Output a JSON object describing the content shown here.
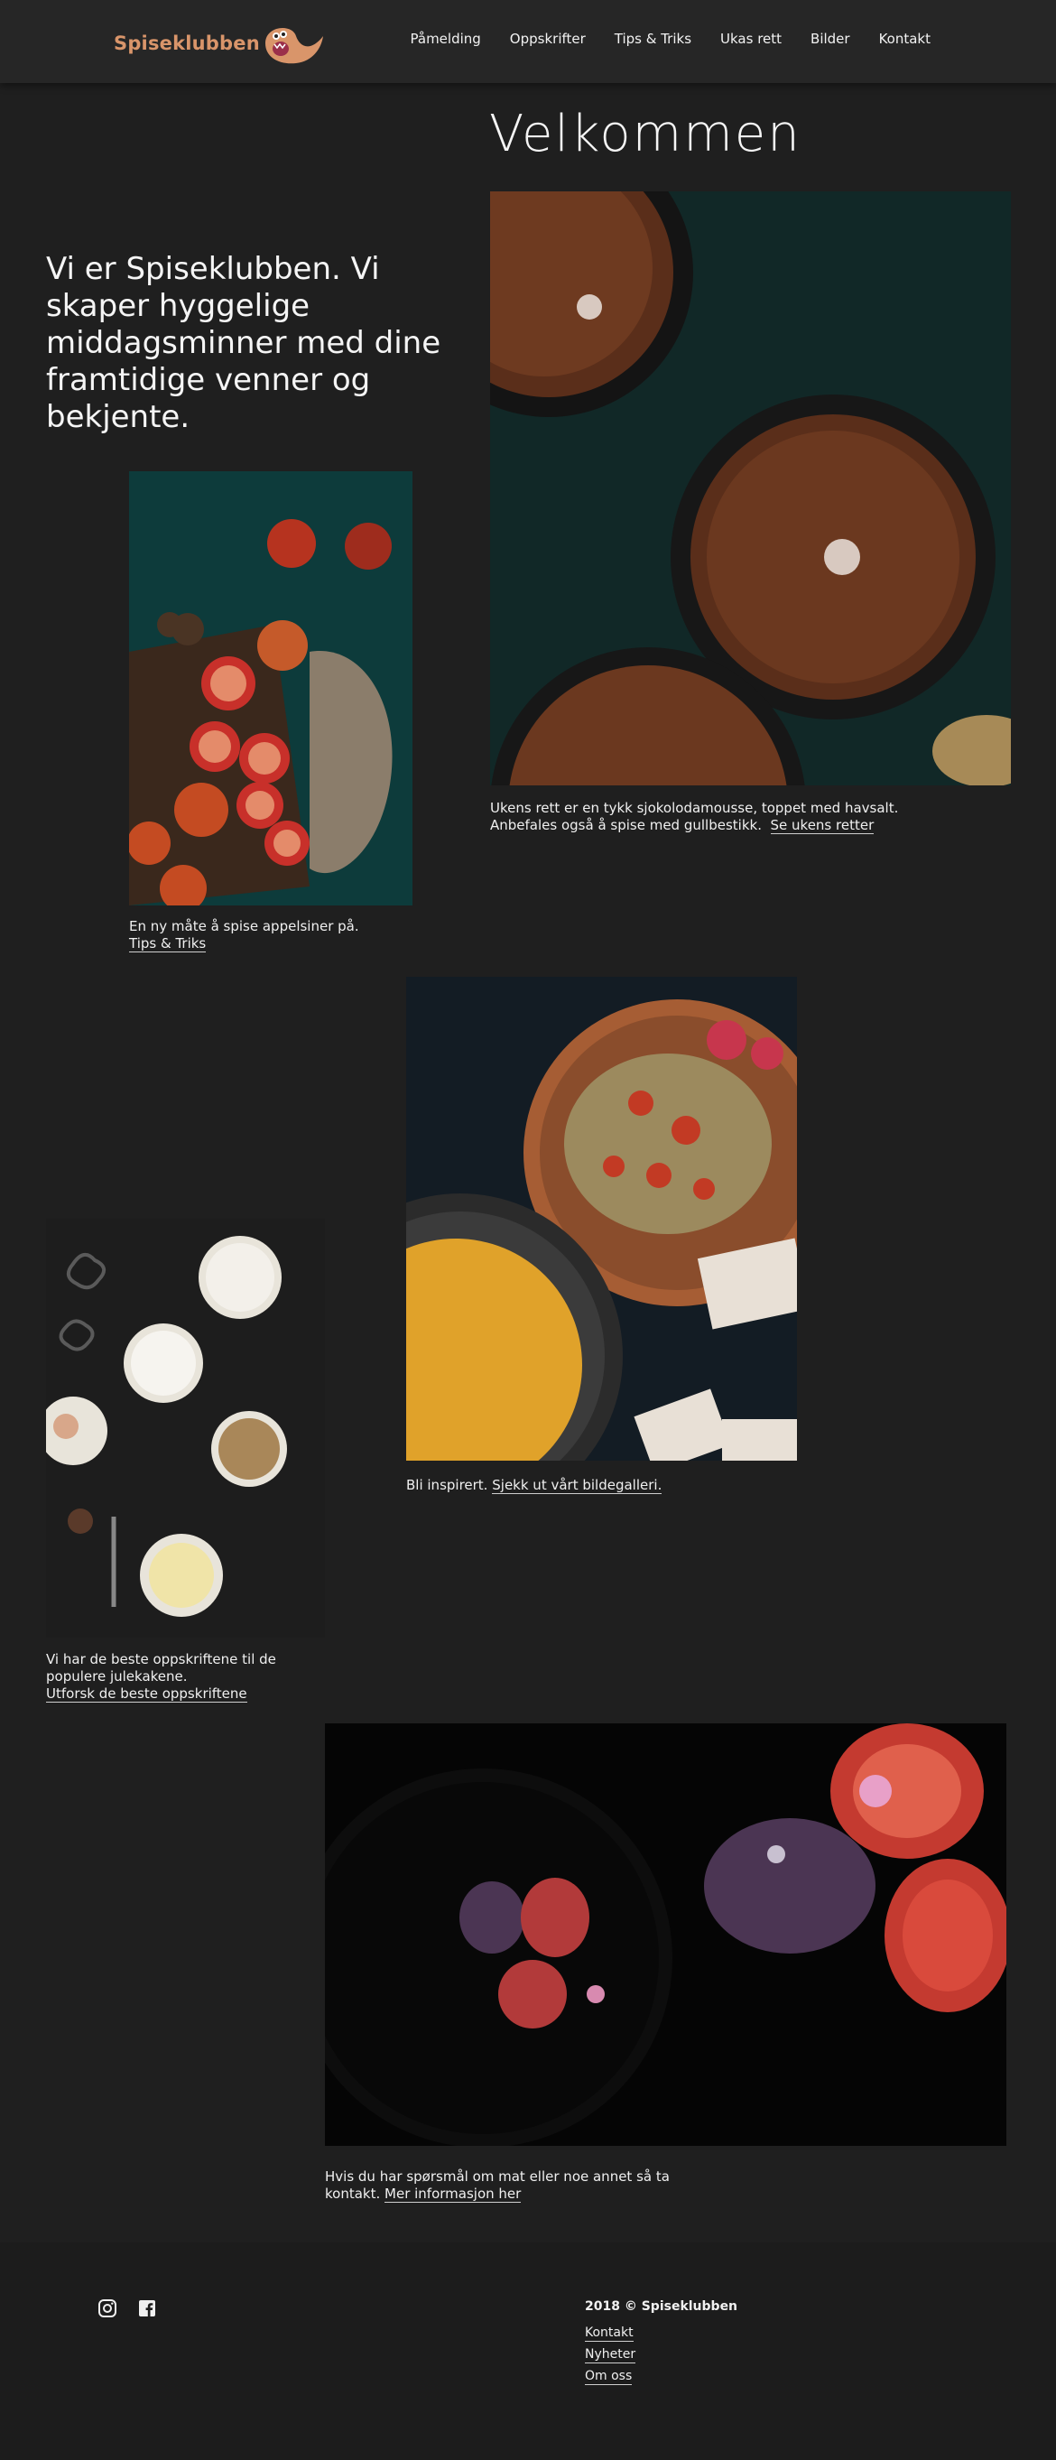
{
  "header": {
    "logo_text": "Spiseklubben",
    "nav": [
      "Påmelding",
      "Oppskrifter",
      "Tips & Triks",
      "Ukas rett",
      "Bilder",
      "Kontakt"
    ]
  },
  "hero": {
    "title": "Velkommen",
    "intro": "Vi er Spiseklubben. Vi skaper hyggelige middagsminner med dine framtidige venner og bekjente."
  },
  "sections": {
    "mousse": {
      "caption": "Ukens rett er en tykk sjokolodamousse, toppet med havsalt. Anbefales også å spise med gullbestikk.",
      "link": "Se ukens retter"
    },
    "oranges": {
      "caption": "En ny måte å spise appelsiner på.",
      "link": "Tips & Triks"
    },
    "hummus": {
      "caption": "Bli inspirert.",
      "link": "Sjekk ut vårt bildegalleri."
    },
    "baking": {
      "caption": "Vi har de beste oppskriftene til de populere julekakene.",
      "link": "Utforsk de beste oppskriftene"
    },
    "figs": {
      "caption": "Hvis du har spørsmål om mat eller noe annet så ta kontakt.",
      "link": "Mer informasjon her"
    }
  },
  "footer": {
    "copyright": "2018 ©  Spiseklubben",
    "links": [
      "Kontakt",
      "Nyheter",
      "Om oss"
    ],
    "social_icons": [
      "instagram-icon",
      "facebook-icon"
    ]
  },
  "colors": {
    "background": "#1f1f1f",
    "header": "#262626",
    "brand": "#d9956a",
    "text": "#f2f2f2"
  }
}
